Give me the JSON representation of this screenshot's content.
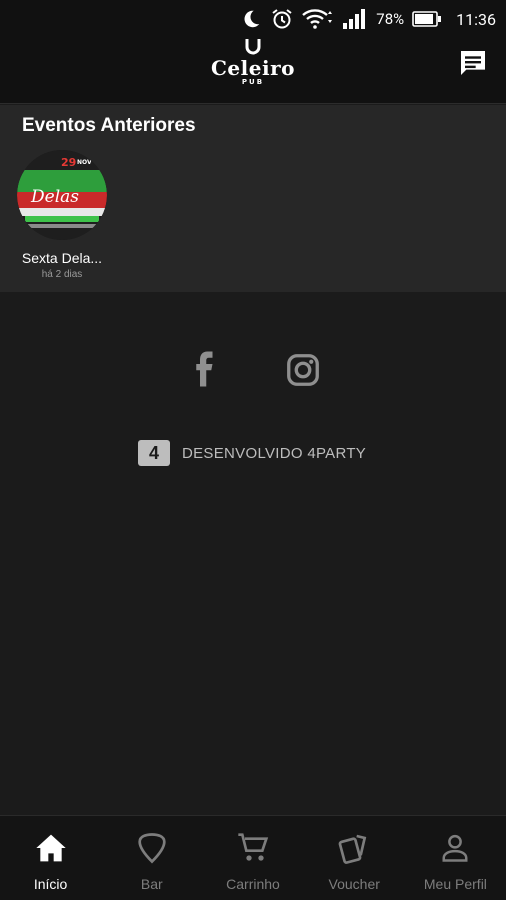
{
  "status_bar": {
    "battery_percent": "78%",
    "time": "11:36"
  },
  "header": {
    "logo_text": "Celeiro",
    "logo_subtext": "PUB"
  },
  "previous_events": {
    "title": "Eventos Anteriores",
    "items": [
      {
        "name": "Sexta Dela...",
        "time": "há 2 dias",
        "thumb_date": "29",
        "thumb_month": "NOV",
        "thumb_text": "Delas"
      }
    ]
  },
  "social": {
    "facebook_icon": "facebook-icon",
    "instagram_icon": "instagram-icon"
  },
  "credit": {
    "logo_mark": "4",
    "text": "DESENVOLVIDO 4PARTY"
  },
  "bottom_nav": {
    "items": [
      {
        "label": "Início",
        "icon": "home-icon",
        "active": true
      },
      {
        "label": "Bar",
        "icon": "guitar-pick-icon",
        "active": false
      },
      {
        "label": "Carrinho",
        "icon": "cart-icon",
        "active": false
      },
      {
        "label": "Voucher",
        "icon": "voucher-icon",
        "active": false
      },
      {
        "label": "Meu Perfil",
        "icon": "person-icon",
        "active": false
      }
    ]
  },
  "colors": {
    "background": "#1b1b1b",
    "section_background": "#272727",
    "header_background": "#111111",
    "inactive": "#7d7d7d",
    "active": "#ffffff"
  }
}
